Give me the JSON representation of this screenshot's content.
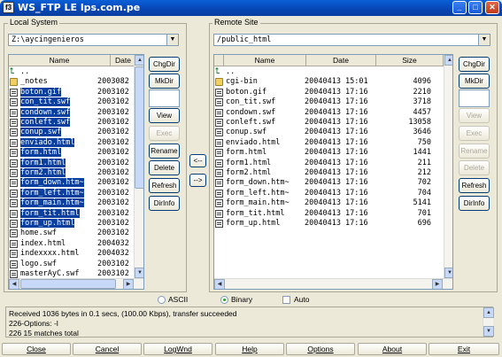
{
  "window": {
    "title": "WS_FTP LE lps.com.pe",
    "app_icon_label": "f3"
  },
  "local": {
    "label": "Local System",
    "path": "Z:\\aycingenieros",
    "columns": [
      "Name",
      "Date"
    ],
    "files": [
      {
        "name": "..",
        "date": "",
        "icon": "up",
        "selected": false
      },
      {
        "name": "_notes",
        "date": "2003082",
        "icon": "folder",
        "selected": false
      },
      {
        "name": "boton.gif",
        "date": "2003102",
        "icon": "file",
        "selected": true
      },
      {
        "name": "con_tit.swf",
        "date": "2003102",
        "icon": "file",
        "selected": true
      },
      {
        "name": "condown.swf",
        "date": "2003102",
        "icon": "file",
        "selected": true
      },
      {
        "name": "conleft.swf",
        "date": "2003102",
        "icon": "file",
        "selected": true
      },
      {
        "name": "conup.swf",
        "date": "2003102",
        "icon": "file",
        "selected": true
      },
      {
        "name": "enviado.html",
        "date": "2003102",
        "icon": "file",
        "selected": true
      },
      {
        "name": "form.html",
        "date": "2003102",
        "icon": "file",
        "selected": true
      },
      {
        "name": "form1.html",
        "date": "2003102",
        "icon": "file",
        "selected": true
      },
      {
        "name": "form2.html",
        "date": "2003102",
        "icon": "file",
        "selected": true
      },
      {
        "name": "form_down.htm~",
        "date": "2003102",
        "icon": "file",
        "selected": true
      },
      {
        "name": "form_left.htm~",
        "date": "2003102",
        "icon": "file",
        "selected": true
      },
      {
        "name": "form_main.htm~",
        "date": "2003102",
        "icon": "file",
        "selected": true
      },
      {
        "name": "form_tit.html",
        "date": "2003102",
        "icon": "file",
        "selected": true
      },
      {
        "name": "form_up.html",
        "date": "2003102",
        "icon": "file",
        "selected": true
      },
      {
        "name": "home.swf",
        "date": "2003102",
        "icon": "file",
        "selected": false
      },
      {
        "name": "index.html",
        "date": "2004032",
        "icon": "file",
        "selected": false
      },
      {
        "name": "indexxxx.html",
        "date": "2004032",
        "icon": "file",
        "selected": false
      },
      {
        "name": "logo.swf",
        "date": "2003102",
        "icon": "file",
        "selected": false
      },
      {
        "name": "masterAyC.swf",
        "date": "2003102",
        "icon": "file",
        "selected": false
      }
    ]
  },
  "remote": {
    "label": "Remote Site",
    "path": "/public_html",
    "columns": [
      "Name",
      "Date",
      "Size"
    ],
    "files": [
      {
        "name": "..",
        "date": "",
        "size": "",
        "icon": "up"
      },
      {
        "name": "cgi-bin",
        "date": "20040413 15:01",
        "size": "4096",
        "icon": "folder"
      },
      {
        "name": "boton.gif",
        "date": "20040413 17:16",
        "size": "2210",
        "icon": "file"
      },
      {
        "name": "con_tit.swf",
        "date": "20040413 17:16",
        "size": "3718",
        "icon": "file"
      },
      {
        "name": "condown.swf",
        "date": "20040413 17:16",
        "size": "4457",
        "icon": "file"
      },
      {
        "name": "conleft.swf",
        "date": "20040413 17:16",
        "size": "13058",
        "icon": "file"
      },
      {
        "name": "conup.swf",
        "date": "20040413 17:16",
        "size": "3646",
        "icon": "file"
      },
      {
        "name": "enviado.html",
        "date": "20040413 17:16",
        "size": "750",
        "icon": "file"
      },
      {
        "name": "form.html",
        "date": "20040413 17:16",
        "size": "1441",
        "icon": "file"
      },
      {
        "name": "form1.html",
        "date": "20040413 17:16",
        "size": "211",
        "icon": "file"
      },
      {
        "name": "form2.html",
        "date": "20040413 17:16",
        "size": "212",
        "icon": "file"
      },
      {
        "name": "form_down.htm~",
        "date": "20040413 17:16",
        "size": "702",
        "icon": "file"
      },
      {
        "name": "form_left.htm~",
        "date": "20040413 17:16",
        "size": "704",
        "icon": "file"
      },
      {
        "name": "form_main.htm~",
        "date": "20040413 17:16",
        "size": "5141",
        "icon": "file"
      },
      {
        "name": "form_tit.html",
        "date": "20040413 17:16",
        "size": "701",
        "icon": "file"
      },
      {
        "name": "form_up.html",
        "date": "20040413 17:16",
        "size": "696",
        "icon": "file"
      }
    ]
  },
  "local_buttons": {
    "chgdir": "ChgDir",
    "mkdir": "MkDir",
    "view": "View",
    "exec": "Exec",
    "rename": "Rename",
    "delete": "Delete",
    "refresh": "Refresh",
    "dirinfo": "DirInfo"
  },
  "remote_buttons": {
    "chgdir": "ChgDir",
    "mkdir": "MkDir",
    "view": "View",
    "exec": "Exec",
    "rename": "Rename",
    "delete": "Delete",
    "refresh": "Refresh",
    "dirinfo": "DirInfo"
  },
  "transfer": {
    "to_local": "<--",
    "to_remote": "-->"
  },
  "mode": {
    "ascii": "ASCII",
    "binary": "Binary",
    "auto": "Auto",
    "selected": "Binary",
    "auto_checked": false
  },
  "log": [
    "Received 1036 bytes in 0.1 secs, (100.00 Kbps), transfer succeeded",
    "226-Options: -l",
    "226 15 matches total"
  ],
  "bottom_buttons": {
    "close": "Close",
    "cancel": "Cancel",
    "logwnd": "LogWnd",
    "help": "Help",
    "options": "Options",
    "about": "About",
    "exit": "Exit"
  },
  "colors": {
    "selection": "#0a3fa0",
    "titlebar": "#0a5fd8"
  }
}
